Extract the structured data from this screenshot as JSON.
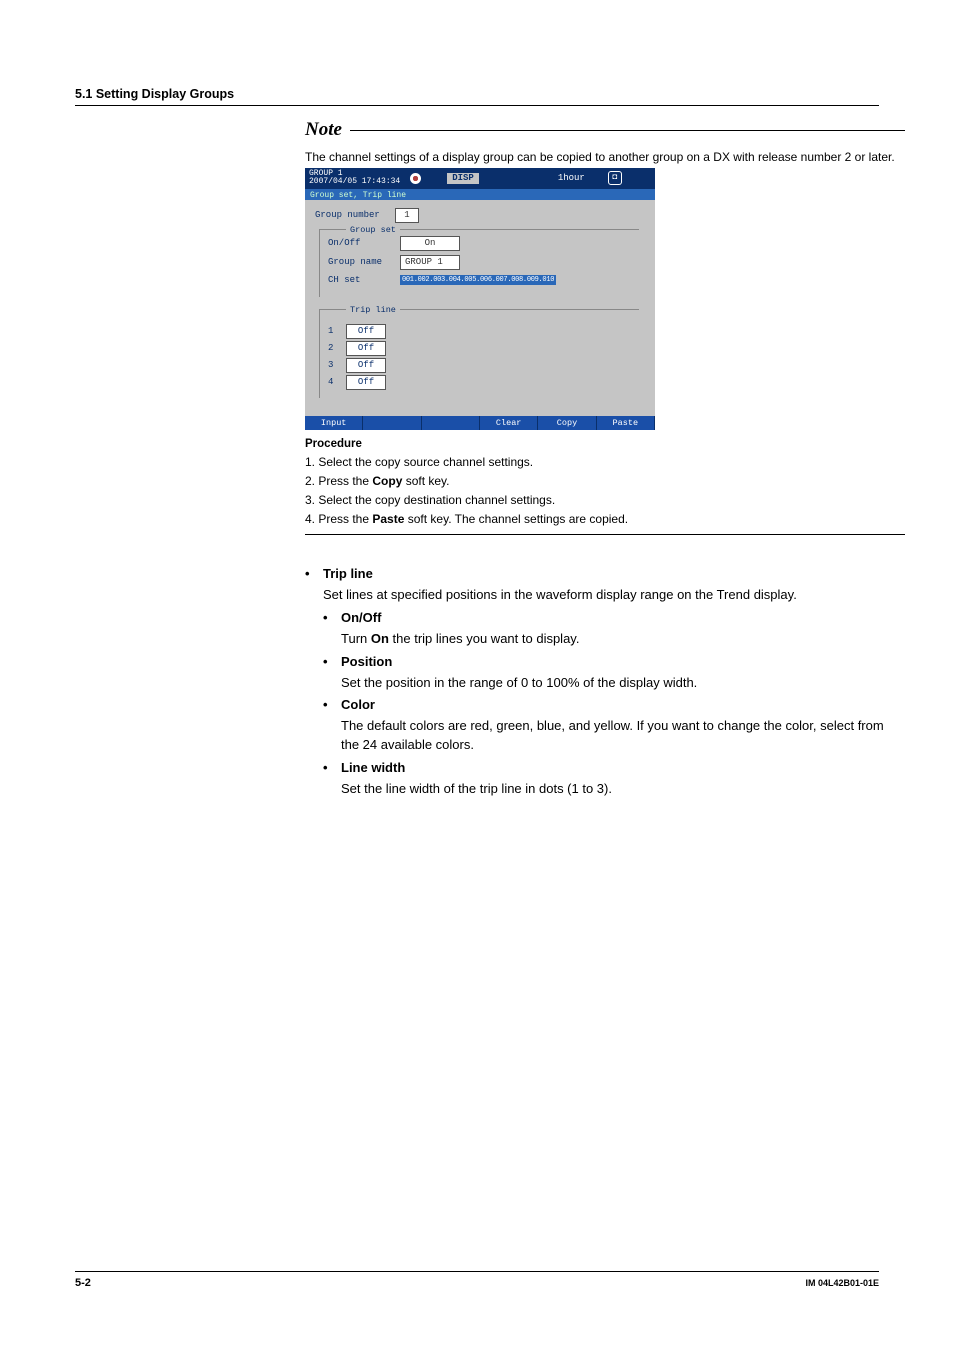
{
  "header": {
    "section": "5.1  Setting Display Groups"
  },
  "note": {
    "label": "Note",
    "text": "The channel settings of a display group can be copied to another group on a DX with release number 2 or later."
  },
  "device": {
    "top": {
      "title": "GROUP 1",
      "datetime": "2007/04/05 17:43:34",
      "disp": "DISP",
      "duration": "1hour",
      "stop_icon": "◘"
    },
    "subbar": "Group set, Trip line",
    "group_number_label": "Group number",
    "group_number_value": "1",
    "group_set_legend": "Group set",
    "onoff_label": "On/Off",
    "onoff_value": "On",
    "group_name_label": "Group name",
    "group_name_value": "GROUP 1",
    "ch_set_label": "CH set",
    "ch_set_value": "001.002.003.004.005.006.007.008.009.010",
    "trip_legend": "Trip line",
    "trip_rows": [
      {
        "n": "1",
        "v": "Off"
      },
      {
        "n": "2",
        "v": "Off"
      },
      {
        "n": "3",
        "v": "Off"
      },
      {
        "n": "4",
        "v": "Off"
      }
    ],
    "footer_btns": [
      "Input",
      "",
      "",
      "Clear",
      "Copy",
      "Paste"
    ]
  },
  "procedure": {
    "head": "Procedure",
    "lines": [
      {
        "pre": "1. Select the copy source channel settings."
      },
      {
        "pre": "2. Press the ",
        "bold": "Copy",
        "post": " soft key."
      },
      {
        "pre": "3. Select the copy destination channel settings."
      },
      {
        "pre": "4. Press the ",
        "bold": "Paste",
        "post": " soft key. The channel settings are copied."
      }
    ]
  },
  "tripline": {
    "title": "Trip line",
    "intro": "Set lines at specified positions in the waveform display range on the Trend display.",
    "onoff_head": "On/Off",
    "onoff_pre": "Turn ",
    "onoff_bold": "On",
    "onoff_post": " the trip lines you want to display.",
    "position_head": "Position",
    "position_body": "Set the position in the range of 0 to 100% of the display width.",
    "color_head": "Color",
    "color_body": "The default colors are red, green, blue, and yellow. If you want to change the color, select from the 24 available colors.",
    "linewidth_head": "Line width",
    "linewidth_body": "Set the line width of the trip line in dots (1 to 3)."
  },
  "footer": {
    "page": "5-2",
    "doc": "IM 04L42B01-01E"
  }
}
